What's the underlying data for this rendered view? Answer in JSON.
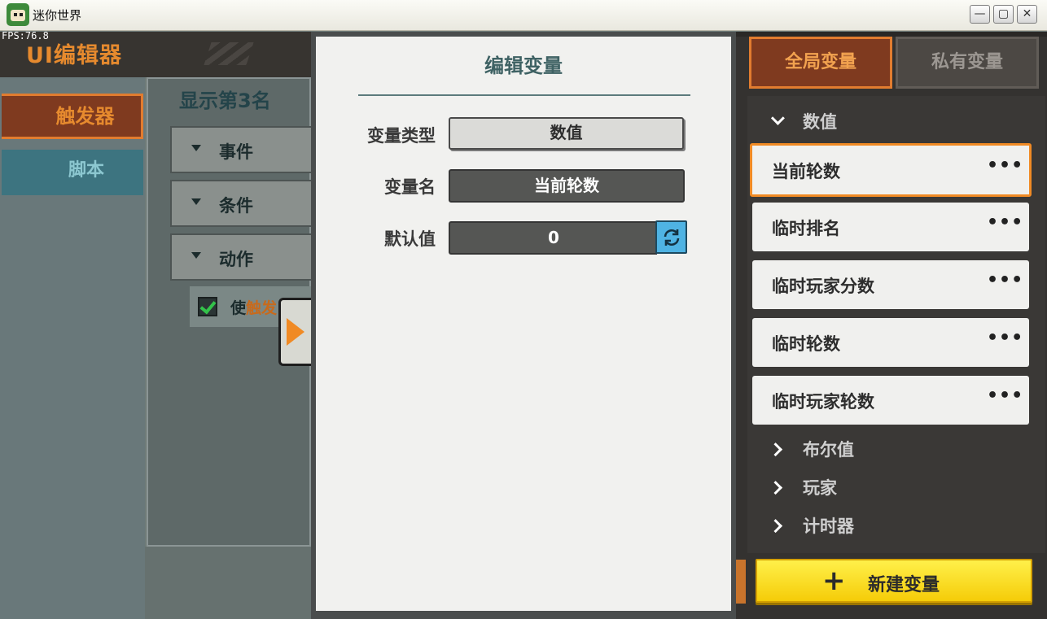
{
  "window": {
    "title": "迷你世界",
    "buttons": {
      "minimize": "—",
      "maximize": "▢",
      "close": "✕"
    }
  },
  "fps": "FPS:76.8",
  "editor": {
    "title": "UI编辑器",
    "tabs": {
      "trigger": "触发器",
      "script": "脚本"
    }
  },
  "rule": {
    "title": "显示第3名",
    "sections": {
      "event": "事件",
      "condition": "条件",
      "action": "动作"
    },
    "action_item": {
      "prefix": "使",
      "highlight": "触发"
    }
  },
  "modal": {
    "title": "编辑变量",
    "fields": {
      "type_label": "变量类型",
      "type_value": "数值",
      "name_label": "变量名",
      "name_value": "当前轮数",
      "default_label": "默认值",
      "default_value": "0"
    }
  },
  "right_panel": {
    "tabs": {
      "global": "全局变量",
      "private": "私有变量"
    },
    "groups": {
      "number": "数值",
      "boolean": "布尔值",
      "player": "玩家",
      "timer": "计时器"
    },
    "variables": [
      {
        "name": "当前轮数",
        "more": "•••"
      },
      {
        "name": "临时排名",
        "more": "•••"
      },
      {
        "name": "临时玩家分数",
        "more": "•••"
      },
      {
        "name": "临时轮数",
        "more": "•••"
      },
      {
        "name": "临时玩家轮数",
        "more": "•••"
      }
    ],
    "new_button": {
      "icon": "+",
      "label": "新建变量"
    }
  },
  "colors": {
    "accent_orange": "#e27c2f",
    "teal_title": "#3f6264",
    "button_yellow": "#f5cc08",
    "refresh_blue": "#4fb3e3"
  },
  "icons": [
    "app-icon",
    "refresh-icon",
    "checkbox-icon",
    "chevron-down-icon",
    "chevron-right-icon",
    "more-icon",
    "plus-icon",
    "play-arrow-icon"
  ]
}
